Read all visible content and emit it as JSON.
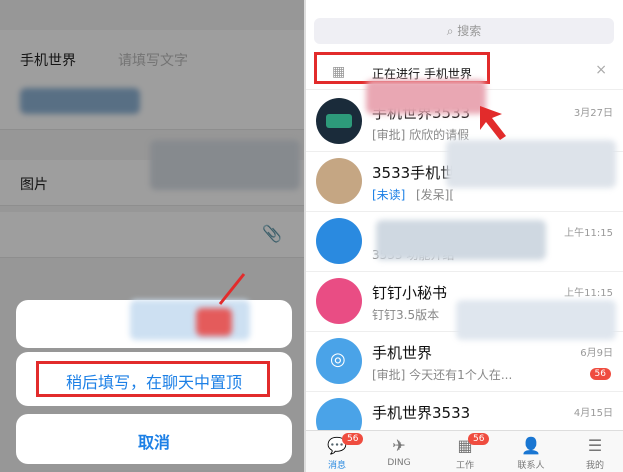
{
  "left": {
    "form_field_label": "手机世界",
    "form_field_placeholder": "请填写文字",
    "image_label": "图片",
    "sheet_top_button": "编",
    "sheet_pin_button": "稍后填写，在聊天中置顶",
    "sheet_cancel_button": "取消"
  },
  "right": {
    "search_placeholder": "搜索",
    "banner_text": "正在进行 手机世界",
    "conversations": [
      {
        "title": "手机世界3533",
        "subtitle": "[审批] 欣欣的请假",
        "time": "3月27日"
      },
      {
        "title": "3533手机世",
        "subtitle_tag": "[未读]",
        "subtitle": "[发呆][",
        "time": ""
      },
      {
        "title": "",
        "subtitle": "3533 功能介绍",
        "time": "上午11:15"
      },
      {
        "title": "钉钉小秘书",
        "subtitle": "钉钉3.5版本",
        "time": "上午11:15"
      },
      {
        "title": "手机世界",
        "subtitle": "[审批] 今天还有1个人在...",
        "time": "6月9日",
        "badge": "56"
      },
      {
        "title": "手机世界3533",
        "subtitle": "",
        "time": "4月15日"
      }
    ],
    "tabs": [
      {
        "label": "消息",
        "icon": "chat-icon",
        "badge": "56"
      },
      {
        "label": "DING",
        "icon": "ding-icon"
      },
      {
        "label": "工作",
        "icon": "grid-icon",
        "badge": "56"
      },
      {
        "label": "联系人",
        "icon": "contacts-icon"
      },
      {
        "label": "我的",
        "icon": "menu-icon"
      }
    ]
  },
  "colors": {
    "accent": "#1d80e6",
    "highlight": "#e22b2b",
    "badge": "#ef4c3f"
  }
}
